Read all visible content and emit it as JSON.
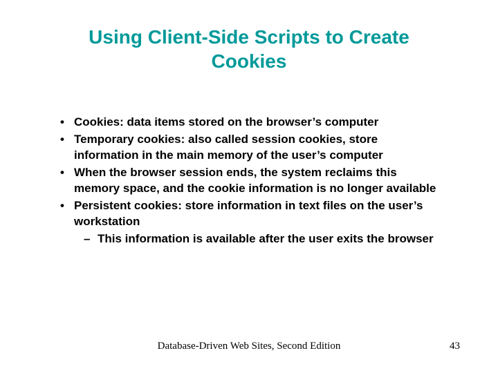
{
  "title": "Using Client-Side Scripts to Create Cookies",
  "bullets": [
    {
      "text": "Cookies: data items stored on the browser’s computer"
    },
    {
      "text": "Temporary cookies: also called session cookies, store information in the main memory of the user’s computer"
    },
    {
      "text": "When the browser session ends, the system reclaims this memory space, and the cookie information is no longer available"
    },
    {
      "text": "Persistent cookies: store information in text files on the user’s workstation",
      "sub": [
        {
          "text": "This information is available after the user exits the browser"
        }
      ]
    }
  ],
  "footer": {
    "center": "Database-Driven Web Sites, Second Edition",
    "page": "43"
  }
}
